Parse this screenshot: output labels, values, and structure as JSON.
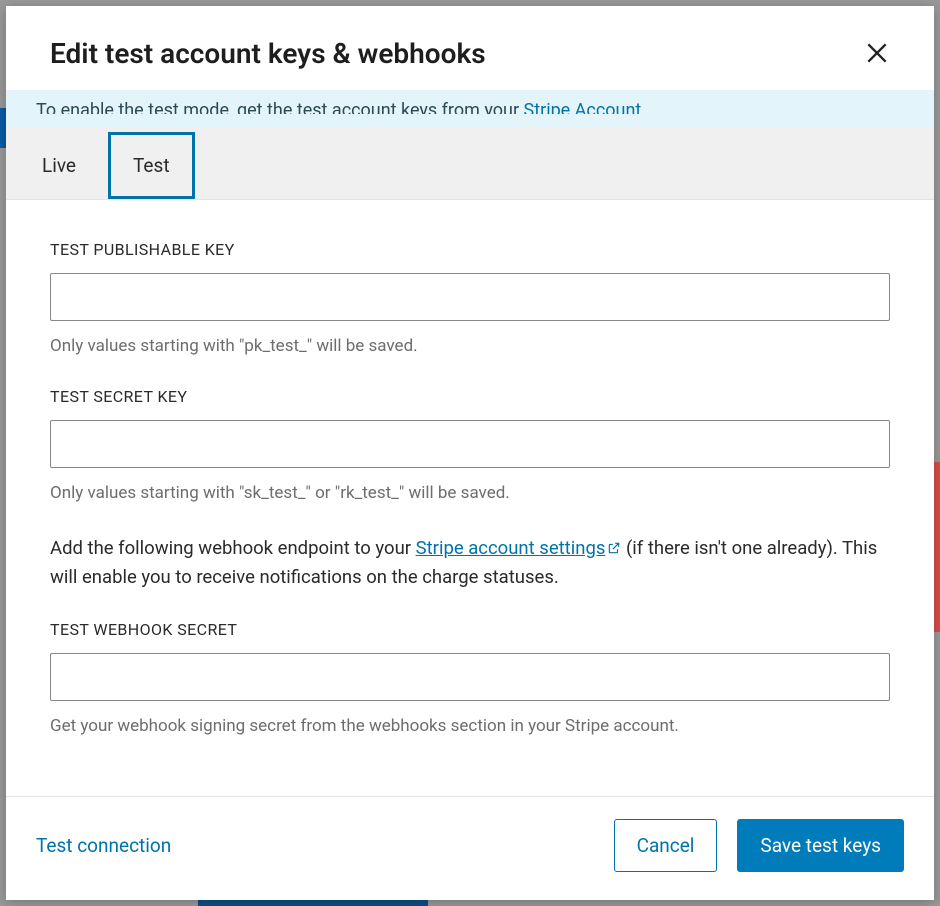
{
  "header": {
    "title": "Edit test account keys & webhooks"
  },
  "notice": {
    "text_cut": "To enable the test mode, get the test account keys from your ",
    "link_cut": "Stripe Account."
  },
  "tabs": {
    "live": "Live",
    "test": "Test"
  },
  "fields": {
    "pub": {
      "label": "TEST PUBLISHABLE KEY",
      "value": "",
      "help": "Only values starting with \"pk_test_\" will be saved."
    },
    "secret": {
      "label": "TEST SECRET KEY",
      "value": "",
      "help": "Only values starting with \"sk_test_\" or \"rk_test_\" will be saved."
    },
    "webhook_info": {
      "pre": "Add the following webhook endpoint  to your ",
      "link": "Stripe account settings",
      "post": " (if there isn't one already). This will enable you to receive notifications on the charge statuses."
    },
    "webhook": {
      "label": "TEST WEBHOOK SECRET",
      "value": "",
      "help": "Get your webhook signing secret from the webhooks section in your Stripe account."
    }
  },
  "footer": {
    "test_connection": "Test connection",
    "cancel": "Cancel",
    "save": "Save test keys"
  }
}
